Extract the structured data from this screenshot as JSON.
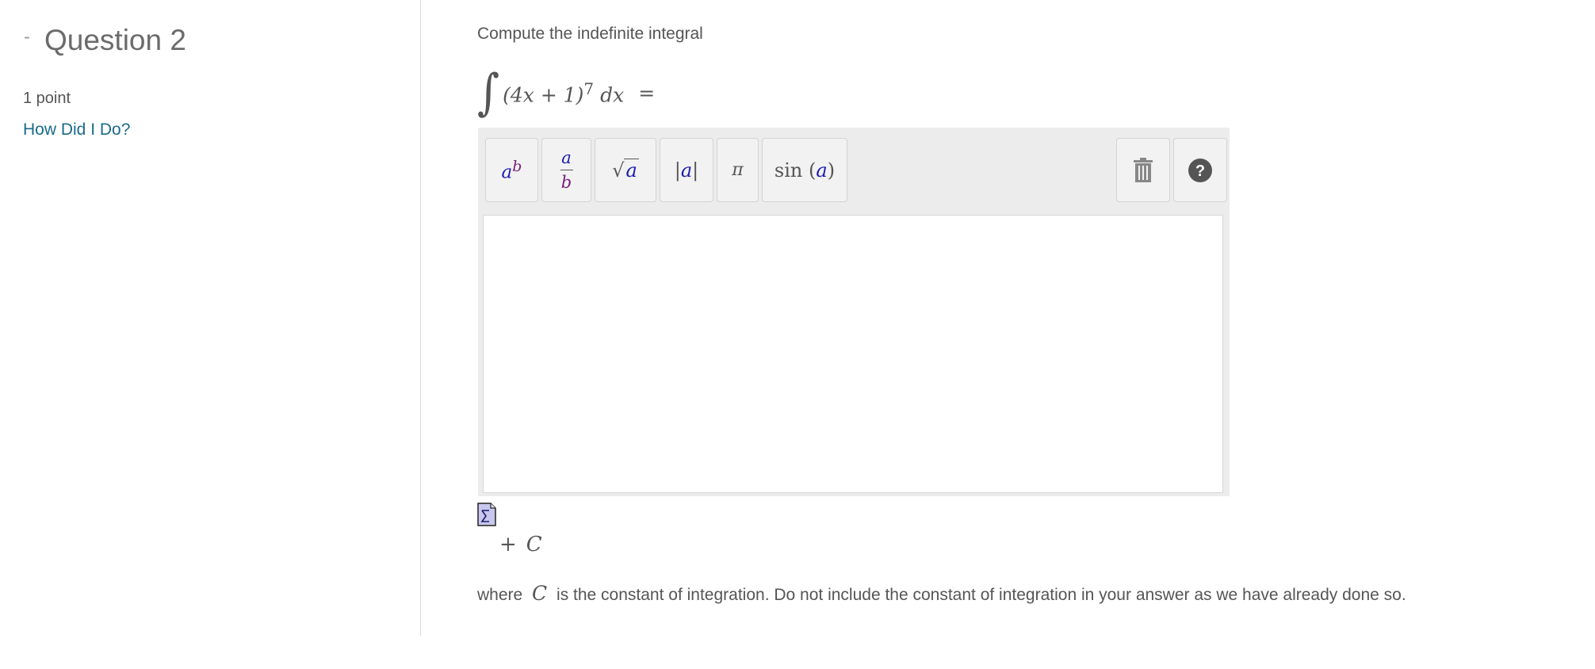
{
  "sidebar": {
    "collapse_symbol": "-",
    "question_title": "Question 2",
    "points": "1 point",
    "how_link": "How Did I Do?"
  },
  "question": {
    "prompt": "Compute the indefinite integral",
    "integral_sign": "∫",
    "integrand": "(4x + 1)",
    "exponent": "7",
    "differential": "dx",
    "equals": "="
  },
  "toolbar": {
    "power": {
      "base": "a",
      "exp": "b"
    },
    "fraction": {
      "num": "a",
      "den": "b"
    },
    "sqrt": {
      "symbol": "√",
      "arg": "a"
    },
    "abs": {
      "left": "|",
      "arg": "a",
      "right": "|"
    },
    "pi": "π",
    "sin": {
      "fn": "sin",
      "open": "(",
      "arg": "a",
      "close": ")"
    },
    "help_symbol": "?"
  },
  "answer": {
    "value": "",
    "plus": "+",
    "constant": "C"
  },
  "note": {
    "before": "where",
    "var": "C",
    "after": "is the constant of integration. Do not include the constant of integration in your answer as we have already done so."
  },
  "colors": {
    "link": "#1a6a8c",
    "variable_a": "#1b1bb3",
    "variable_b": "#7a1f7a",
    "help_bg": "#555555"
  }
}
